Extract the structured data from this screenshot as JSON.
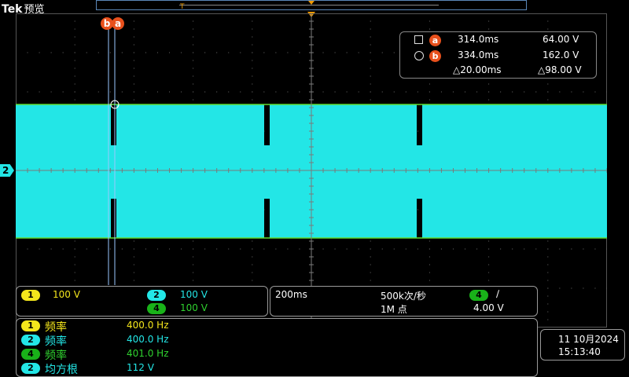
{
  "header": {
    "brand": "Tek",
    "mode": "预览"
  },
  "record": {
    "marker_label": "T"
  },
  "cursors": {
    "b_label": "b",
    "a_label": "a"
  },
  "trace": {
    "channel_label": "2"
  },
  "cursor_readout": {
    "rows": [
      {
        "label": "a",
        "time": "314.0ms",
        "value": "64.00 V"
      },
      {
        "label": "b",
        "time": "334.0ms",
        "value": "162.0 V"
      }
    ],
    "delta_time": "△20.00ms",
    "delta_value": "△98.00 V"
  },
  "vertical_panel": {
    "ch1": {
      "label": "1",
      "scale": "100 V"
    },
    "ch2": {
      "label": "2",
      "scale": "100 V"
    },
    "ch4": {
      "label": "4",
      "scale": "100 V"
    }
  },
  "horizontal_panel": {
    "timebase": "200ms",
    "sample_rate": "500k次/秒",
    "record_length": "1M 点",
    "trigger_source": "4",
    "trigger_slope": "∕",
    "trigger_level": "4.00 V"
  },
  "measurements": [
    {
      "channel": "1",
      "label": "频率",
      "value": "400.0 Hz"
    },
    {
      "channel": "2",
      "label": "频率",
      "value": "400.0 Hz"
    },
    {
      "channel": "4",
      "label": "频率",
      "value": "401.0 Hz"
    },
    {
      "channel": "2",
      "label": "均方根",
      "value": "112 V"
    }
  ],
  "clock": {
    "date": "11 10月2024",
    "time": "15:13:40"
  },
  "colors": {
    "ch1": "#f4e61c",
    "ch2": "#23e6e6",
    "ch4": "#19b219",
    "cursor": "#e8501c",
    "trigger": "#f09a00"
  }
}
